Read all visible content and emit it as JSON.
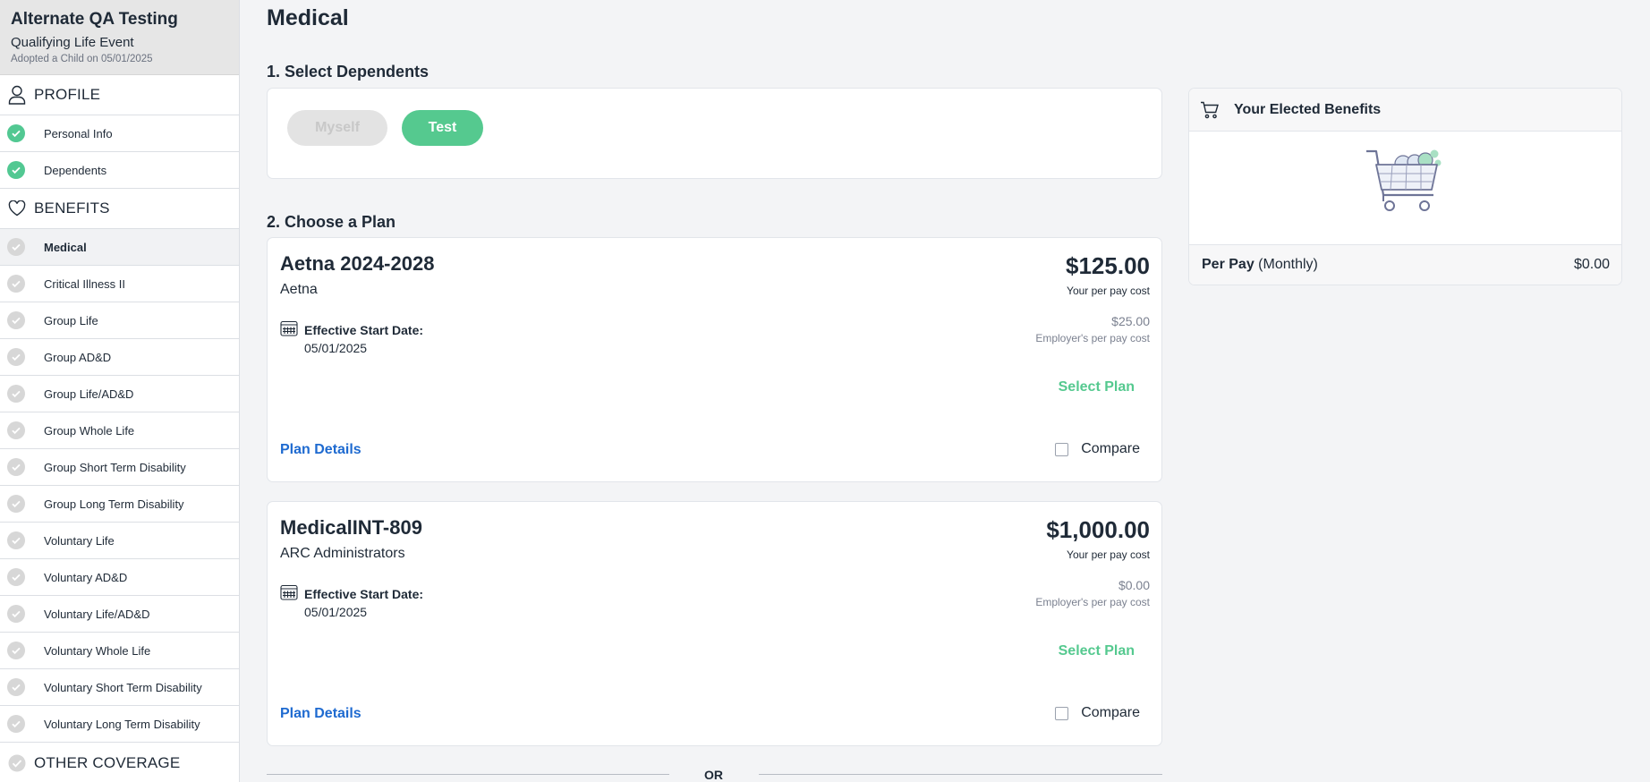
{
  "sidebar": {
    "company": "Alternate QA Testing",
    "event_title": "Qualifying Life Event",
    "event_subtitle": "Adopted a Child on 05/01/2025",
    "sections": [
      {
        "label": "PROFILE",
        "icon": "person-icon",
        "items": [
          {
            "label": "Personal Info",
            "status": "complete"
          },
          {
            "label": "Dependents",
            "status": "complete"
          }
        ]
      },
      {
        "label": "BENEFITS",
        "icon": "heart-icon",
        "items": [
          {
            "label": "Medical",
            "status": "pending",
            "active": true
          },
          {
            "label": "Critical Illness II",
            "status": "pending"
          },
          {
            "label": "Group Life",
            "status": "pending"
          },
          {
            "label": "Group AD&D",
            "status": "pending"
          },
          {
            "label": "Group Life/AD&D",
            "status": "pending"
          },
          {
            "label": "Group Whole Life",
            "status": "pending"
          },
          {
            "label": "Group Short Term Disability",
            "status": "pending"
          },
          {
            "label": "Group Long Term Disability",
            "status": "pending"
          },
          {
            "label": "Voluntary Life",
            "status": "pending"
          },
          {
            "label": "Voluntary AD&D",
            "status": "pending"
          },
          {
            "label": "Voluntary Life/AD&D",
            "status": "pending"
          },
          {
            "label": "Voluntary Whole Life",
            "status": "pending"
          },
          {
            "label": "Voluntary Short Term Disability",
            "status": "pending"
          },
          {
            "label": "Voluntary Long Term Disability",
            "status": "pending"
          }
        ]
      },
      {
        "label": "OTHER COVERAGE",
        "icon": "check-circle-icon",
        "items": []
      }
    ]
  },
  "main": {
    "page_title": "Medical",
    "step1_title": "1. Select Dependents",
    "dependents": [
      {
        "label": "Myself",
        "selected": false
      },
      {
        "label": "Test",
        "selected": true
      }
    ],
    "step2_title": "2. Choose a Plan",
    "plans": [
      {
        "name": "Aetna 2024-2028",
        "carrier": "Aetna",
        "price": "$125.00",
        "price_label": "Your per pay cost",
        "employer_price": "$25.00",
        "employer_label": "Employer's per pay cost",
        "effective_label": "Effective Start Date:",
        "effective_date": "05/01/2025",
        "select_label": "Select Plan",
        "details_label": "Plan Details",
        "compare_label": "Compare"
      },
      {
        "name": "MedicalINT-809",
        "carrier": "ARC Administrators",
        "price": "$1,000.00",
        "price_label": "Your per pay cost",
        "employer_price": "$0.00",
        "employer_label": "Employer's per pay cost",
        "effective_label": "Effective Start Date:",
        "effective_date": "05/01/2025",
        "select_label": "Select Plan",
        "details_label": "Plan Details",
        "compare_label": "Compare"
      }
    ],
    "or_label": "OR"
  },
  "elected": {
    "title": "Your Elected Benefits",
    "per_pay_label": "Per Pay",
    "per_pay_period": "(Monthly)",
    "per_pay_amount": "$0.00"
  },
  "colors": {
    "accent_green": "#55c98f",
    "link_blue": "#1e6ad0",
    "text_dark": "#1f2a37",
    "pending_gray": "#d7d7d7"
  }
}
